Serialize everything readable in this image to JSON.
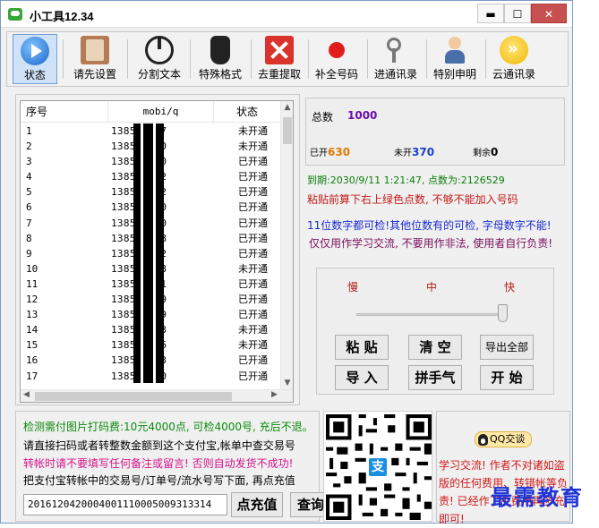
{
  "window": {
    "title": "小工具12.34",
    "controls": {
      "minimize": "▬",
      "maximize": "☐",
      "close": "✕"
    }
  },
  "toolbar": {
    "items": [
      {
        "label": "状态",
        "icon": "play-icon"
      },
      {
        "label": "请先设置",
        "icon": "settings-book-icon"
      },
      {
        "label": "分割文本",
        "icon": "power-icon"
      },
      {
        "label": "特殊格式",
        "icon": "hand-icon"
      },
      {
        "label": "去重提取",
        "icon": "red-x-icon"
      },
      {
        "label": "补全号码",
        "icon": "red-dot-icon"
      },
      {
        "label": "进通讯录",
        "icon": "keys-icon"
      },
      {
        "label": "特别申明",
        "icon": "person-icon"
      },
      {
        "label": "云通讯录",
        "icon": "cloud-sync-icon"
      }
    ]
  },
  "list": {
    "columns": [
      "序号",
      "mobi/q",
      "状态"
    ],
    "rows": [
      {
        "idx": "1",
        "mobi": "1385  1  17",
        "status": "未开通"
      },
      {
        "idx": "2",
        "mobi": "1385  1  60",
        "status": "未开通"
      },
      {
        "idx": "3",
        "mobi": "1385  1  50",
        "status": "已开通"
      },
      {
        "idx": "4",
        "mobi": "1385  1  52",
        "status": "已开通"
      },
      {
        "idx": "5",
        "mobi": "1385  1  92",
        "status": "已开通"
      },
      {
        "idx": "6",
        "mobi": "1385  1  70",
        "status": "已开通"
      },
      {
        "idx": "7",
        "mobi": "1385  1  20",
        "status": "已开通"
      },
      {
        "idx": "8",
        "mobi": "1385  1  88",
        "status": "已开通"
      },
      {
        "idx": "9",
        "mobi": "1385  1  92",
        "status": "已开通"
      },
      {
        "idx": "10",
        "mobi": "1385  1  38",
        "status": "未开通"
      },
      {
        "idx": "11",
        "mobi": "1385  1  41",
        "status": "已开通"
      },
      {
        "idx": "12",
        "mobi": "1385  1  19",
        "status": "已开通"
      },
      {
        "idx": "13",
        "mobi": "1385  1  99",
        "status": "已开通"
      },
      {
        "idx": "14",
        "mobi": "1385  1  93",
        "status": "未开通"
      },
      {
        "idx": "15",
        "mobi": "1385  1  46",
        "status": "未开通"
      },
      {
        "idx": "16",
        "mobi": "1385  1  93",
        "status": "已开通"
      },
      {
        "idx": "17",
        "mobi": "1385  1  90",
        "status": "已开通"
      },
      {
        "idx": "",
        "mobi": "",
        "status": ""
      }
    ]
  },
  "stats": {
    "total_label": "总数",
    "total_value": "1000",
    "opened_label": "已开",
    "opened_value": "630",
    "unopened_label": "未开",
    "unopened_value": "370",
    "left_label": "剩余",
    "left_value": "0"
  },
  "info": {
    "expire": "到期:2030/9/11  1:21:47, 点数为:2126529",
    "warn": "粘贴前算下右上绿色点数, 不够不能加入号码",
    "note1": "11位数字都可检!其他位数有的可检, 字母数字不能!",
    "note2": "仅仅用作学习交流, 不要用作非法, 使用者自行负责!"
  },
  "controls": {
    "speed_slow": "慢",
    "speed_mid": "中",
    "speed_fast": "快",
    "speed_level": "fast",
    "paste": "粘 贴",
    "clear": "清 空",
    "export_all": "导出全部",
    "import": "导 入",
    "luck": "拼手气",
    "start": "开 始"
  },
  "recharge": {
    "line1": "检测需付图片打码费:10元4000点, 可检4000号, 充后不退。",
    "line2": "请直接扫码或者转整数金额到这个支付宝,帐单中查交易号",
    "line3": "转帐时请不要填写任何备注或留言! 否则自动发货不成功!",
    "line4": "把支付宝转帐中的交易号/订单号/流水号写下面, 再点充值",
    "order_value": "2016120420004001110005009313314",
    "recharge_btn": "点充值",
    "query_btn": "查询"
  },
  "qr": {
    "logo_glyph": "支"
  },
  "contact": {
    "qq_label": "QQ交谈",
    "text": "学习交流! 作者不对诸如盗版的任何费用、转错帐等负责! 已经作了免费用再多充即可!"
  },
  "watermark": "最需教育"
}
